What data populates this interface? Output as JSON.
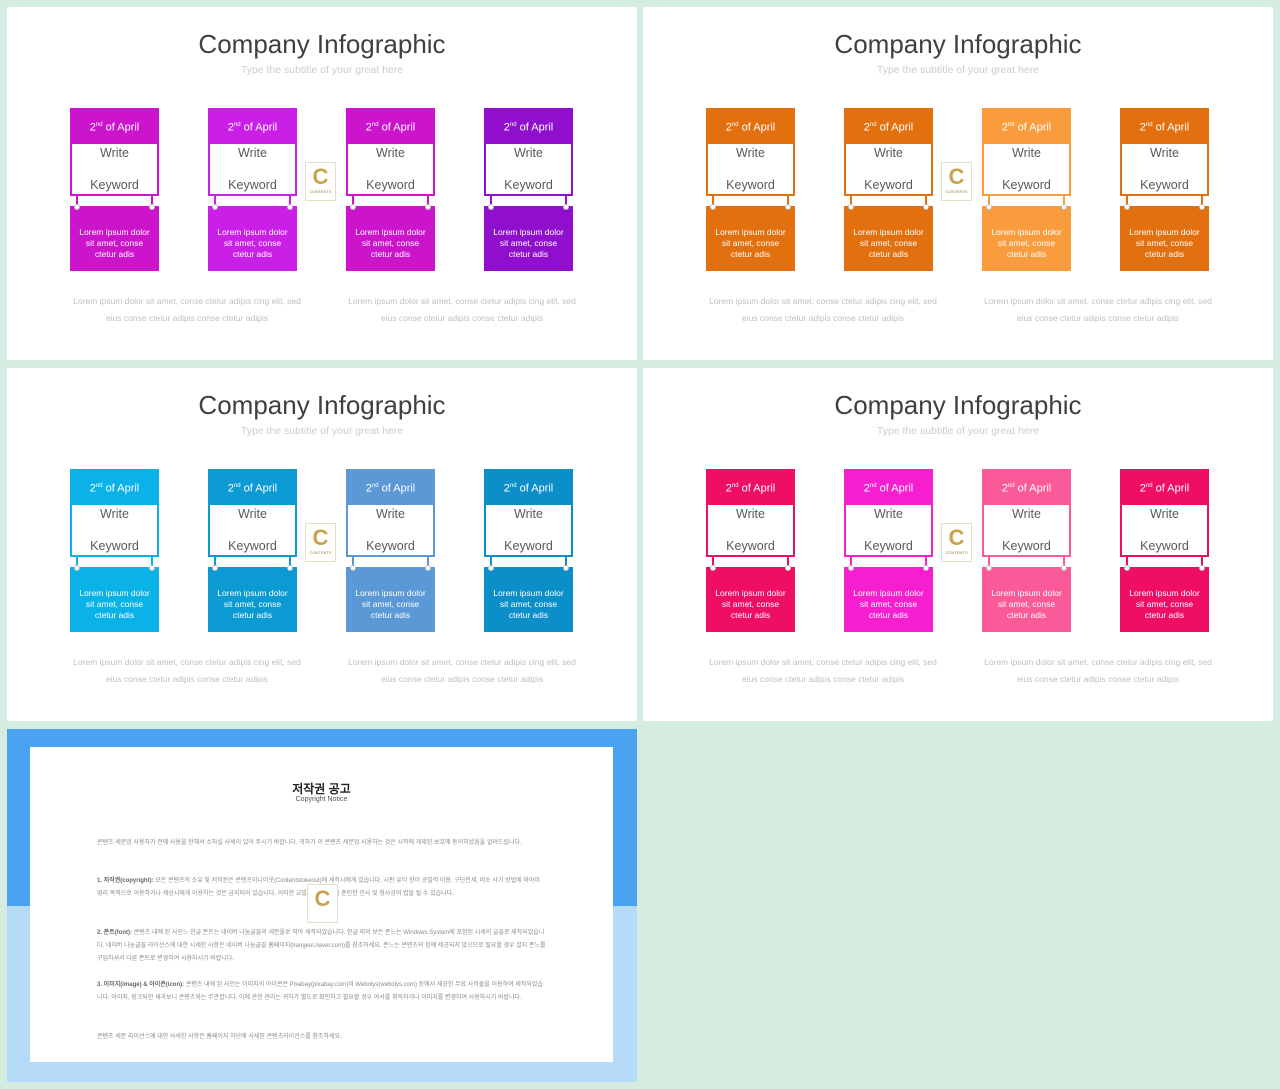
{
  "slides": [
    {
      "title": "Company Infographic",
      "subtitle": "Type the subtitle of your great here",
      "cards": [
        {
          "day": "2",
          "sup": "nd",
          "month": " of April",
          "keyword_1": "Write",
          "keyword_2": "Keyword",
          "body": "Lorem ipsum dolor sit amet, conse ctetur adis",
          "color": "#cc14cc"
        },
        {
          "day": "2",
          "sup": "nd",
          "month": " of April",
          "keyword_1": "Write",
          "keyword_2": "Keyword",
          "body": "Lorem ipsum dolor sit amet, conse ctetur adis",
          "color": "#c91fe6"
        },
        {
          "day": "2",
          "sup": "nd",
          "month": " of April",
          "keyword_1": "Write",
          "keyword_2": "Keyword",
          "body": "Lorem ipsum dolor sit amet, conse ctetur adis",
          "color": "#cc14cc"
        },
        {
          "day": "2",
          "sup": "nd",
          "month": " of April",
          "keyword_1": "Write",
          "keyword_2": "Keyword",
          "body": "Lorem ipsum dolor sit amet, conse ctetur adis",
          "color": "#8f0fcc"
        }
      ],
      "descriptions": [
        "Lorem ipsum dolor sit amet, conse ctetur adipis cing elit, sed eius conse ctetur adipis conse ctetur adipis",
        "Lorem ipsum dolor sit amet, conse ctetur adipis cing elit, sed eius conse ctetur adipis conse ctetur adipis"
      ],
      "logo_letter": "C",
      "logo_text": "CONTENTS"
    },
    {
      "title": "Company Infographic",
      "subtitle": "Type the subtitle of your great here",
      "cards": [
        {
          "day": "2",
          "sup": "nd",
          "month": " of April",
          "keyword_1": "Write",
          "keyword_2": "Keyword",
          "body": "Lorem ipsum dolor sit amet, conse ctetur adis",
          "color": "#e2700f"
        },
        {
          "day": "2",
          "sup": "nd",
          "month": " of April",
          "keyword_1": "Write",
          "keyword_2": "Keyword",
          "body": "Lorem ipsum dolor sit amet, conse ctetur adis",
          "color": "#e2700f"
        },
        {
          "day": "2",
          "sup": "nd",
          "month": " of April",
          "keyword_1": "Write",
          "keyword_2": "Keyword",
          "body": "Lorem ipsum dolor sit amet, conse ctetur adis",
          "color": "#f99c3e"
        },
        {
          "day": "2",
          "sup": "nd",
          "month": " of April",
          "keyword_1": "Write",
          "keyword_2": "Keyword",
          "body": "Lorem ipsum dolor sit amet, conse ctetur adis",
          "color": "#e2700f"
        }
      ],
      "descriptions": [
        "Lorem ipsum dolor sit amet, conse ctetur adipis cing elit, sed eius conse ctetur adipis conse ctetur adipis",
        "Lorem ipsum dolor sit amet, conse ctetur adipis cing elit, sed eius conse ctetur adipis conse ctetur adipis"
      ],
      "logo_letter": "C",
      "logo_text": "CONTENTS"
    },
    {
      "title": "Company Infographic",
      "subtitle": "Type the subtitle of your great here",
      "cards": [
        {
          "day": "2",
          "sup": "nd",
          "month": " of April",
          "keyword_1": "Write",
          "keyword_2": "Keyword",
          "body": "Lorem ipsum dolor sit amet, conse ctetur adis",
          "color": "#0ab2e8"
        },
        {
          "day": "2",
          "sup": "nd",
          "month": " of April",
          "keyword_1": "Write",
          "keyword_2": "Keyword",
          "body": "Lorem ipsum dolor sit amet, conse ctetur adis",
          "color": "#0b9ad2"
        },
        {
          "day": "2",
          "sup": "nd",
          "month": " of April",
          "keyword_1": "Write",
          "keyword_2": "Keyword",
          "body": "Lorem ipsum dolor sit amet, conse ctetur adis",
          "color": "#5a98d6"
        },
        {
          "day": "2",
          "sup": "nd",
          "month": " of April",
          "keyword_1": "Write",
          "keyword_2": "Keyword",
          "body": "Lorem ipsum dolor sit amet, conse ctetur adis",
          "color": "#0c8fc8"
        }
      ],
      "descriptions": [
        "Lorem ipsum dolor sit amet, conse ctetur adipis cing elit, sed eius conse ctetur adipis conse ctetur adipis",
        "Lorem ipsum dolor sit amet, conse ctetur adipis cing elit, sed eius conse ctetur adipis conse ctetur adipis"
      ],
      "logo_letter": "C",
      "logo_text": "CONTENTS"
    },
    {
      "title": "Company Infographic",
      "subtitle": "Type the subtitle of your great here",
      "cards": [
        {
          "day": "2",
          "sup": "nd",
          "month": " of April",
          "keyword_1": "Write",
          "keyword_2": "Keyword",
          "body": "Lorem ipsum dolor sit amet, conse ctetur adis",
          "color": "#ee0e63"
        },
        {
          "day": "2",
          "sup": "nd",
          "month": " of April",
          "keyword_1": "Write",
          "keyword_2": "Keyword",
          "body": "Lorem ipsum dolor sit amet, conse ctetur adis",
          "color": "#f51fd0"
        },
        {
          "day": "2",
          "sup": "nd",
          "month": " of April",
          "keyword_1": "Write",
          "keyword_2": "Keyword",
          "body": "Lorem ipsum dolor sit amet, conse ctetur adis",
          "color": "#fa5a97"
        },
        {
          "day": "2",
          "sup": "nd",
          "month": " of April",
          "keyword_1": "Write",
          "keyword_2": "Keyword",
          "body": "Lorem ipsum dolor sit amet, conse ctetur adis",
          "color": "#ee0e63"
        }
      ],
      "descriptions": [
        "Lorem ipsum dolor sit amet, conse ctetur adipis cing elit, sed eius conse ctetur adipis conse ctetur adipis",
        "Lorem ipsum dolor sit amet, conse ctetur adipis cing elit, sed eius conse ctetur adipis conse ctetur adipis"
      ],
      "logo_letter": "C",
      "logo_text": "CONTENTS"
    }
  ],
  "copyright": {
    "title": "저작권 공고",
    "subtitle": "Copyright Notice",
    "intro": "콘텐츠 세문업 사용자가 전에 사용을 한해서 소하실 사세이 있어 주시기 바랍니다. 귀하가 이 콘텐츠 세문업 사용하는 것은 시작에 게재된 보호에 동의하셨음을 알려드립니다.",
    "items": [
      {
        "label": "1. 저작권(copyright):",
        "text": "모든 콘텐츠의 소유 및 저작권은 콘텐츠이니이웃(Contentstokeout)에 세작시에게 있습니다. 시판 유익 향이 공빌력 이용, 구단전세, 비소 사기 방법에 와아이 영리 목적으로 이용하거나 세상시에게 이용하는 것은 금지되어 있습니다. 이러한 교빌 행위 발된 시 준인한 민사 및 형사상의 법알 될 수 있습니다."
      },
      {
        "label": "2. 폰트(font):",
        "text": "콘텐츠 내에 된 사인느 한글 폰트는 네이버 나눔글꼴의 세분을로 작아 세작되었습니다. 한글 외의 보든 폰느는 Windows System에 포함된 시세의 글꼴로 세작되었습니다. 네이버 나눔글꼴 라이선스에 대한 시세한 사항은 네이버 나눔글꼴 홈페이지(hangeul.naver.com)를 참조하세요. 폰느는 콘텐츠의 함께 세공되지 않으므로 필요할 경우 설지 폰느를 구입하셔서 다른 폰트로 변경하여 사용하시기 바랍니다."
      },
      {
        "label": "3. 이미지(image) & 아이콘(icon):",
        "text": "콘텐츠 내에 된 사인는 이미지의 아이콘은 Pixabay(pixabay.com)와 Webolys(webolys.com) 등에서 세공한 무료 사작물을 이용하여 세작되었습니다. 아이지, 링크되한 세과보니 콘텐츠와는 무관합니다. 이에 관한 관리는 귀하가 별도로 확인하고 필요할 경우 여서를 취득하거나 이미지를 변경하여 사용하시기 바랍니다."
      }
    ],
    "footer": "콘텐츠 세문 라이선스에 대한 사세한 사항은 홈페이지 하단에 사세된 콘텐츠라이선스를 참조하세요.",
    "logo_letter": "C"
  }
}
